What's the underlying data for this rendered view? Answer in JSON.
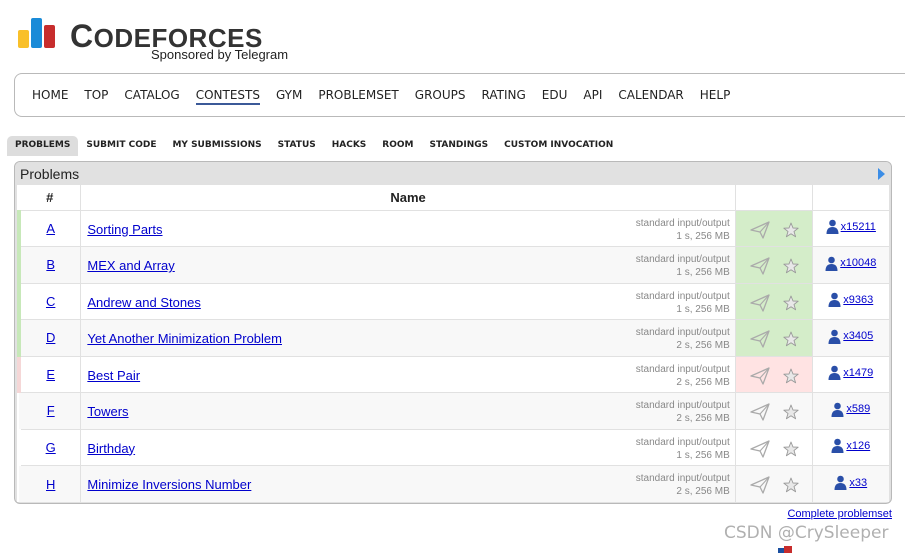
{
  "header": {
    "logo_title_first": "C",
    "logo_title_rest": "ODEFORCES",
    "logo_subtitle": "Sponsored by Telegram",
    "logo_bar_colors": [
      "#f9c02a",
      "#1a8bd8",
      "#c72d2d"
    ]
  },
  "main_nav": {
    "items": [
      {
        "label": "HOME",
        "active": false
      },
      {
        "label": "TOP",
        "active": false
      },
      {
        "label": "CATALOG",
        "active": false
      },
      {
        "label": "CONTESTS",
        "active": true
      },
      {
        "label": "GYM",
        "active": false
      },
      {
        "label": "PROBLEMSET",
        "active": false
      },
      {
        "label": "GROUPS",
        "active": false
      },
      {
        "label": "RATING",
        "active": false
      },
      {
        "label": "EDU",
        "active": false
      },
      {
        "label": "API",
        "active": false
      },
      {
        "label": "CALENDAR",
        "active": false
      },
      {
        "label": "HELP",
        "active": false
      }
    ]
  },
  "sub_nav": {
    "tabs": [
      {
        "label": "PROBLEMS",
        "active": true
      },
      {
        "label": "SUBMIT CODE",
        "active": false
      },
      {
        "label": "MY SUBMISSIONS",
        "active": false
      },
      {
        "label": "STATUS",
        "active": false
      },
      {
        "label": "HACKS",
        "active": false
      },
      {
        "label": "ROOM",
        "active": false
      },
      {
        "label": "STANDINGS",
        "active": false
      },
      {
        "label": "CUSTOM INVOCATION",
        "active": false
      }
    ]
  },
  "problems": {
    "title": "Problems",
    "columns": {
      "id": "#",
      "name": "Name"
    },
    "rows": [
      {
        "id": "A",
        "name": "Sorting Parts",
        "io": "standard input/output",
        "limits": "1 s, 256 MB",
        "solved": "x15211",
        "status": "accepted"
      },
      {
        "id": "B",
        "name": "MEX and Array",
        "io": "standard input/output",
        "limits": "1 s, 256 MB",
        "solved": "x10048",
        "status": "accepted"
      },
      {
        "id": "C",
        "name": "Andrew and Stones",
        "io": "standard input/output",
        "limits": "1 s, 256 MB",
        "solved": "x9363",
        "status": "accepted"
      },
      {
        "id": "D",
        "name": "Yet Another Minimization Problem",
        "io": "standard input/output",
        "limits": "2 s, 256 MB",
        "solved": "x3405",
        "status": "accepted"
      },
      {
        "id": "E",
        "name": "Best Pair",
        "io": "standard input/output",
        "limits": "2 s, 256 MB",
        "solved": "x1479",
        "status": "rejected"
      },
      {
        "id": "F",
        "name": "Towers",
        "io": "standard input/output",
        "limits": "2 s, 256 MB",
        "solved": "x589",
        "status": "none"
      },
      {
        "id": "G",
        "name": "Birthday",
        "io": "standard input/output",
        "limits": "1 s, 256 MB",
        "solved": "x126",
        "status": "none"
      },
      {
        "id": "H",
        "name": "Minimize Inversions Number",
        "io": "standard input/output",
        "limits": "2 s, 256 MB",
        "solved": "x33",
        "status": "none"
      }
    ]
  },
  "footer": {
    "complete_link": "Complete problemset"
  },
  "watermark": "CSDN @CrySleeper",
  "colors": {
    "link": "#0000cc",
    "accepted": "#d4edc9",
    "rejected": "#ffe3e3",
    "nav_active_underline": "#3b5998"
  }
}
